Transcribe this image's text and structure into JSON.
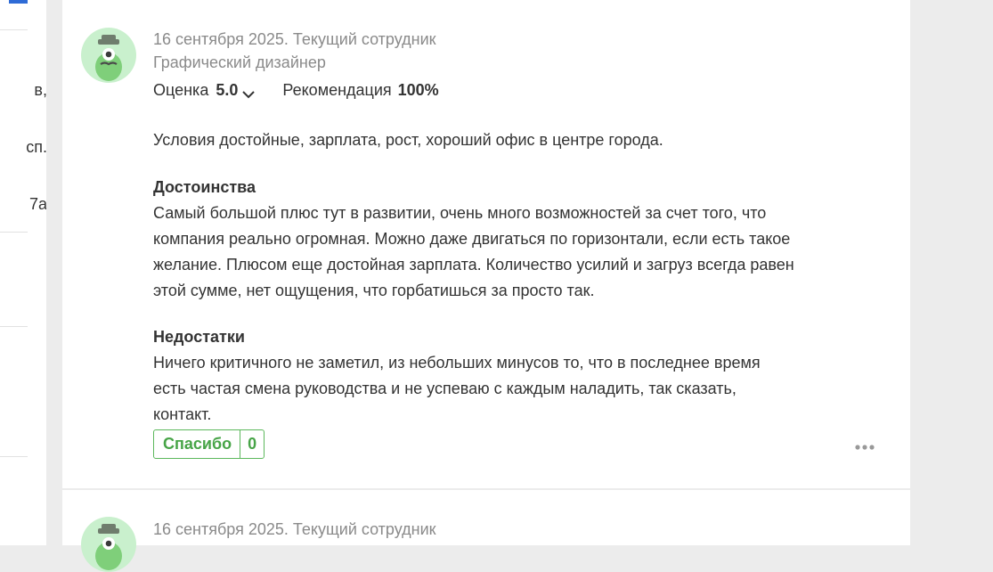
{
  "left_panel": {
    "fragments": [
      "в,",
      "сп.",
      "7а"
    ]
  },
  "review": {
    "meta": "16 сентября 2025. Текущий сотрудник",
    "position": "Графический дизайнер",
    "rating_label": "Оценка",
    "rating_value": "5.0",
    "recommend_label": "Рекомендация",
    "recommend_value": "100%",
    "summary": "Условия достойные, зарплата, рост, хороший офис в центре города.",
    "pros_title": "Достоинства",
    "pros_text": "Самый большой плюс тут в развитии, очень много возможностей за счет того, что компания реально огромная. Можно даже двигаться по горизонтали, если есть такое желание. Плюсом еще достойная зарплата. Количество усилий и загруз всегда равен этой сумме, нет ощущения, что горбатишься за просто так.",
    "cons_title": "Недостатки",
    "cons_text": "Ничего критичного не заметил, из небольших минусов то, что в последнее время есть частая смена руководства и не успеваю с каждым наладить, так сказать, контакт.",
    "thanks_label": "Спасибо",
    "thanks_count": "0"
  },
  "next_review": {
    "meta": "16 сентября 2025. Текущий сотрудник"
  },
  "colors": {
    "accent_green": "#5cb85c",
    "avatar_bg": "#c9f0cd",
    "avatar_char": "#7fcf7a"
  },
  "icons": {
    "rating_toggle": "chevron-down-icon",
    "more": "more-dots-icon",
    "avatar": "monster-avatar-icon"
  }
}
